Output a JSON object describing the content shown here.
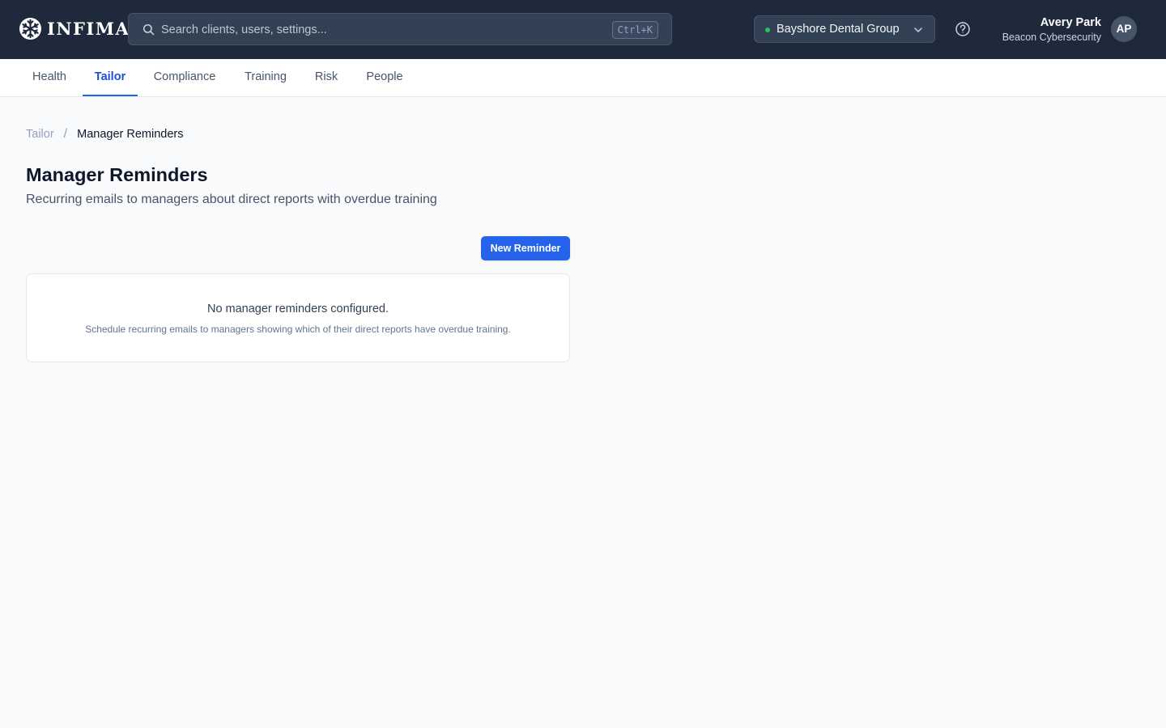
{
  "app": {
    "logo_text": "INFIMA"
  },
  "search": {
    "placeholder": "Search clients, users, settings...",
    "shortcut": "Ctrl+K"
  },
  "client_selector": {
    "name": "Bayshore Dental Group",
    "status_color": "#22c55e"
  },
  "user": {
    "name": "Avery Park",
    "org": "Beacon Cybersecurity",
    "initials": "AP"
  },
  "tabs": [
    {
      "label": "Health",
      "active": false
    },
    {
      "label": "Tailor",
      "active": true
    },
    {
      "label": "Compliance",
      "active": false
    },
    {
      "label": "Training",
      "active": false
    },
    {
      "label": "Risk",
      "active": false
    },
    {
      "label": "People",
      "active": false
    }
  ],
  "breadcrumb": {
    "parent": "Tailor",
    "separator": "/",
    "current": "Manager Reminders"
  },
  "page": {
    "title": "Manager Reminders",
    "subtitle": "Recurring emails to managers about direct reports with overdue training",
    "new_button_label": "New Reminder"
  },
  "empty_state": {
    "title": "No manager reminders configured.",
    "description": "Schedule recurring emails to managers showing which of their direct reports have overdue training."
  },
  "colors": {
    "topbar": "#1e293b",
    "accent": "#2563eb"
  },
  "icons": {
    "logo": "snowflake-icon",
    "search": "search-icon",
    "dropdown": "chevron-down-icon",
    "help": "help-circle-icon"
  }
}
